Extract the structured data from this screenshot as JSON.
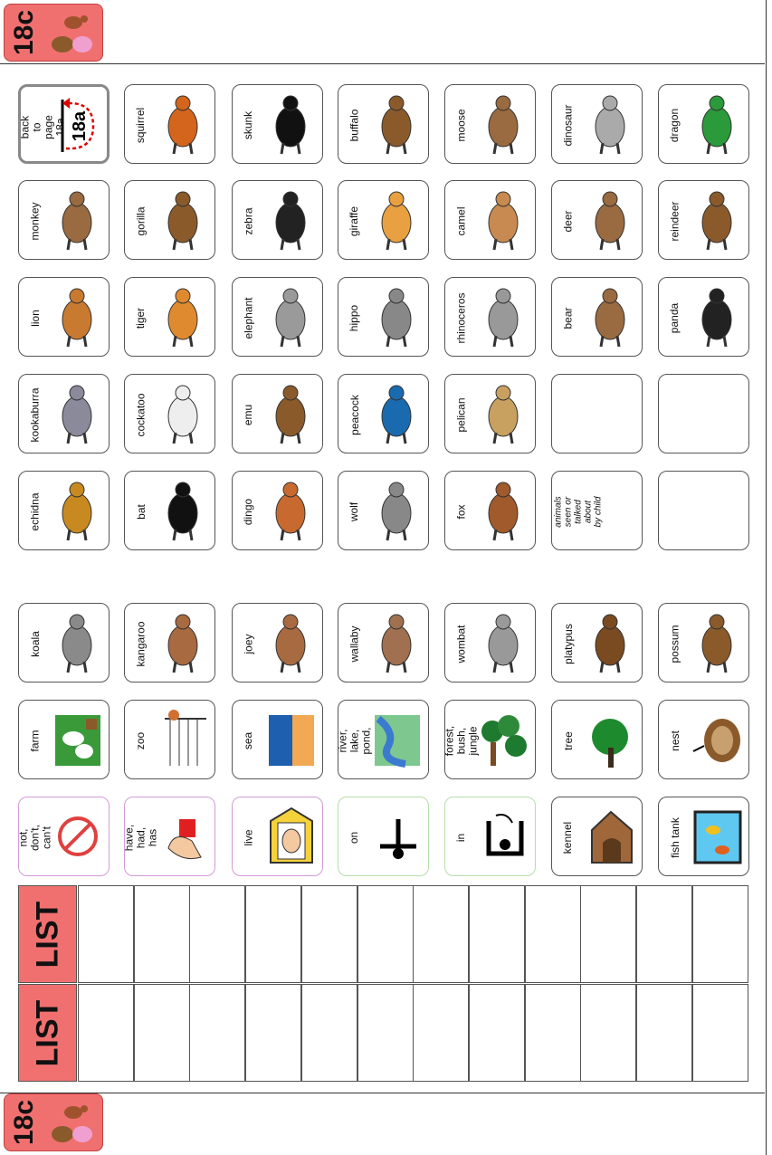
{
  "page_tab": {
    "label": "18c"
  },
  "back_cell": {
    "text": "go back to page 18a",
    "page_ref": "18a"
  },
  "rows_top": [
    [
      {
        "label": "squirrel",
        "icon": "squirrel-icon"
      },
      {
        "label": "skunk",
        "icon": "skunk-icon"
      },
      {
        "label": "buffalo",
        "icon": "buffalo-icon"
      },
      {
        "label": "moose",
        "icon": "moose-icon"
      },
      {
        "label": "dinosaur",
        "icon": "dinosaur-icon"
      },
      {
        "label": "dragon",
        "icon": "dragon-icon"
      }
    ],
    [
      {
        "label": "monkey",
        "icon": "monkey-icon"
      },
      {
        "label": "gorilla",
        "icon": "gorilla-icon"
      },
      {
        "label": "zebra",
        "icon": "zebra-icon"
      },
      {
        "label": "giraffe",
        "icon": "giraffe-icon"
      },
      {
        "label": "camel",
        "icon": "camel-icon"
      },
      {
        "label": "deer",
        "icon": "deer-icon"
      },
      {
        "label": "reindeer",
        "icon": "reindeer-icon"
      }
    ],
    [
      {
        "label": "lion",
        "icon": "lion-icon"
      },
      {
        "label": "tiger",
        "icon": "tiger-icon"
      },
      {
        "label": "elephant",
        "icon": "elephant-icon"
      },
      {
        "label": "hippo",
        "icon": "hippo-icon"
      },
      {
        "label": "rhinoceros",
        "icon": "rhinoceros-icon"
      },
      {
        "label": "bear",
        "icon": "bear-icon"
      },
      {
        "label": "panda",
        "icon": "panda-icon"
      }
    ],
    [
      {
        "label": "kookaburra",
        "icon": "kookaburra-icon"
      },
      {
        "label": "cockatoo",
        "icon": "cockatoo-icon"
      },
      {
        "label": "emu",
        "icon": "emu-icon"
      },
      {
        "label": "peacock",
        "icon": "peacock-icon"
      },
      {
        "label": "pelican",
        "icon": "pelican-icon"
      },
      {
        "label": "",
        "icon": ""
      },
      {
        "label": "",
        "icon": ""
      }
    ],
    [
      {
        "label": "echidna",
        "icon": "echidna-icon"
      },
      {
        "label": "bat",
        "icon": "bat-icon"
      },
      {
        "label": "dingo",
        "icon": "dingo-icon"
      },
      {
        "label": "wolf",
        "icon": "wolf-icon"
      },
      {
        "label": "fox",
        "icon": "fox-icon"
      },
      {
        "label": "add other animals seen or talked about by child",
        "icon": ""
      },
      {
        "label": "",
        "icon": ""
      }
    ]
  ],
  "rows_bottom": [
    [
      {
        "label": "koala",
        "icon": "koala-icon"
      },
      {
        "label": "kangaroo",
        "icon": "kangaroo-icon"
      },
      {
        "label": "joey",
        "icon": "joey-icon"
      },
      {
        "label": "wallaby",
        "icon": "wallaby-icon"
      },
      {
        "label": "wombat",
        "icon": "wombat-icon"
      },
      {
        "label": "platypus",
        "icon": "platypus-icon"
      },
      {
        "label": "possum",
        "icon": "possum-icon"
      }
    ],
    [
      {
        "label": "farm",
        "icon": "farm-icon"
      },
      {
        "label": "zoo",
        "icon": "zoo-icon"
      },
      {
        "label": "sea",
        "icon": "sea-icon"
      },
      {
        "label": "river, lake, pond,",
        "icon": "river-icon"
      },
      {
        "label": "forest, bush, jungle",
        "icon": "forest-icon"
      },
      {
        "label": "tree",
        "icon": "tree-icon"
      },
      {
        "label": "nest",
        "icon": "nest-icon"
      }
    ],
    [
      {
        "label": "not, don't, can't",
        "icon": "no-symbol-icon"
      },
      {
        "label": "have, had, has",
        "icon": "hand-holding-icon"
      },
      {
        "label": "live",
        "icon": "house-face-icon"
      },
      {
        "label": "on",
        "icon": "on-symbol-icon"
      },
      {
        "label": "in",
        "icon": "in-symbol-icon"
      },
      {
        "label": "kennel",
        "icon": "kennel-icon"
      },
      {
        "label": "fish tank",
        "icon": "fish-tank-icon"
      }
    ]
  ],
  "list": {
    "header_1": "LIST",
    "header_2": "LIST"
  },
  "colors": {
    "tab": "#f07070",
    "pink_border": "#d49ad8",
    "green_border": "#b5dfa8"
  }
}
